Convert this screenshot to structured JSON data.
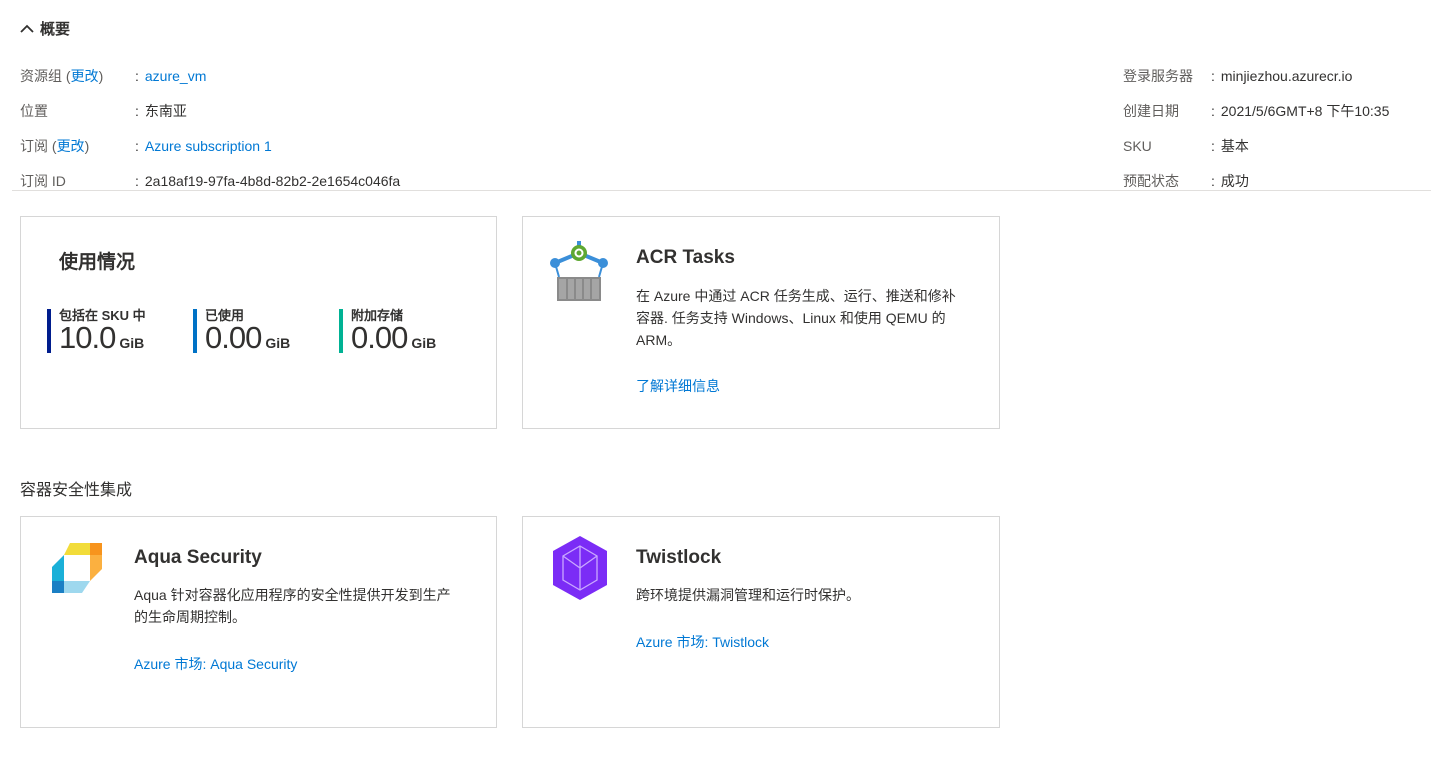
{
  "header": {
    "title": "概要"
  },
  "essentials": {
    "left": [
      {
        "label": "资源组",
        "change": "更改",
        "value": "azure_vm",
        "link": true
      },
      {
        "label": "位置",
        "value": "东南亚",
        "link": false
      },
      {
        "label": "订阅",
        "change": "更改",
        "value": "Azure subscription 1",
        "link": true
      },
      {
        "label": "订阅 ID",
        "value": "2a18af19-97fa-4b8d-82b2-2e1654c046fa",
        "link": false
      }
    ],
    "right": [
      {
        "label": "登录服务器",
        "value": "minjiezhou.azurecr.io"
      },
      {
        "label": "创建日期",
        "value": "2021/5/6GMT+8 下午10:35"
      },
      {
        "label": "SKU",
        "value": "基本"
      },
      {
        "label": "预配状态",
        "value": "成功"
      }
    ]
  },
  "usage": {
    "title": "使用情况",
    "metrics": [
      {
        "label": "包括在 SKU 中",
        "value": "10.0",
        "unit": "GiB",
        "color": "#001d8d"
      },
      {
        "label": "已使用",
        "value": "0.00",
        "unit": "GiB",
        "color": "#0072c6"
      },
      {
        "label": "附加存储",
        "value": "0.00",
        "unit": "GiB",
        "color": "#00b294"
      }
    ]
  },
  "acr": {
    "title": "ACR Tasks",
    "desc": "在 Azure 中通过 ACR 任务生成、运行、推送和修补容器. 任务支持 Windows、Linux 和使用 QEMU 的 ARM。",
    "link": "了解详细信息"
  },
  "security_section": "容器安全性集成",
  "aqua": {
    "title": "Aqua Security",
    "desc": "Aqua 针对容器化应用程序的安全性提供开发到生产的生命周期控制。",
    "link": "Azure 市场: Aqua Security"
  },
  "twistlock": {
    "title": "Twistlock",
    "desc": "跨环境提供漏洞管理和运行时保护。",
    "link": "Azure 市场: Twistlock"
  }
}
